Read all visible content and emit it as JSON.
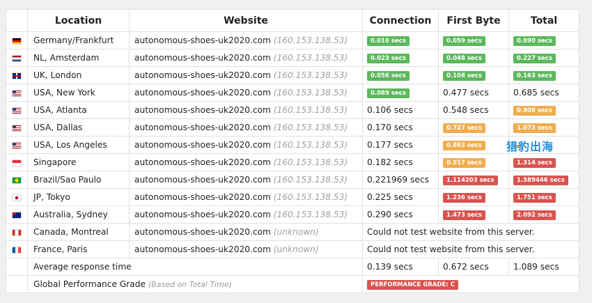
{
  "headers": {
    "location": "Location",
    "website": "Website",
    "connection": "Connection",
    "first_byte": "First Byte",
    "total": "Total"
  },
  "rows": [
    {
      "flag": "de",
      "location": "Germany/Frankfurt",
      "site": "autonomous-shoes-uk2020.com",
      "ip": "(160.153.138.53)",
      "connection": {
        "text": "0.010 secs",
        "style": "green"
      },
      "first_byte": {
        "text": "0.059 secs",
        "style": "green"
      },
      "total": {
        "text": "0.090 secs",
        "style": "green"
      }
    },
    {
      "flag": "nl",
      "location": "NL, Amsterdam",
      "site": "autonomous-shoes-uk2020.com",
      "ip": "(160.153.138.53)",
      "connection": {
        "text": "0.023 secs",
        "style": "green"
      },
      "first_byte": {
        "text": "0.048 secs",
        "style": "green"
      },
      "total": {
        "text": "0.227 secs",
        "style": "green"
      }
    },
    {
      "flag": "gb",
      "location": "UK, London",
      "site": "autonomous-shoes-uk2020.com",
      "ip": "(160.153.138.53)",
      "connection": {
        "text": "0.056 secs",
        "style": "green"
      },
      "first_byte": {
        "text": "0.108 secs",
        "style": "green"
      },
      "total": {
        "text": "0.163 secs",
        "style": "green"
      }
    },
    {
      "flag": "us",
      "location": "USA, New York",
      "site": "autonomous-shoes-uk2020.com",
      "ip": "(160.153.138.53)",
      "connection": {
        "text": "0.089 secs",
        "style": "green"
      },
      "first_byte": {
        "text": "0.477 secs",
        "style": "plain"
      },
      "total": {
        "text": "0.685 secs",
        "style": "plain"
      }
    },
    {
      "flag": "us",
      "location": "USA, Atlanta",
      "site": "autonomous-shoes-uk2020.com",
      "ip": "(160.153.138.53)",
      "connection": {
        "text": "0.106 secs",
        "style": "plain"
      },
      "first_byte": {
        "text": "0.548 secs",
        "style": "plain"
      },
      "total": {
        "text": "0.906 secs",
        "style": "orange"
      }
    },
    {
      "flag": "us",
      "location": "USA, Dallas",
      "site": "autonomous-shoes-uk2020.com",
      "ip": "(160.153.138.53)",
      "connection": {
        "text": "0.170 secs",
        "style": "plain"
      },
      "first_byte": {
        "text": "0.727 secs",
        "style": "orange"
      },
      "total": {
        "text": "1.073 secs",
        "style": "orange"
      }
    },
    {
      "flag": "us",
      "location": "USA, Los Angeles",
      "site": "autonomous-shoes-uk2020.com",
      "ip": "(160.153.138.53)",
      "connection": {
        "text": "0.177 secs",
        "style": "plain"
      },
      "first_byte": {
        "text": "0.863 secs",
        "style": "orange"
      },
      "total": {
        "text": "",
        "style": "orange"
      }
    },
    {
      "flag": "sg",
      "location": "Singapore",
      "site": "autonomous-shoes-uk2020.com",
      "ip": "(160.153.138.53)",
      "connection": {
        "text": "0.182 secs",
        "style": "plain"
      },
      "first_byte": {
        "text": "0.917 secs",
        "style": "orange"
      },
      "total": {
        "text": "1.314 secs",
        "style": "red"
      }
    },
    {
      "flag": "br",
      "location": "Brazil/Sao Paulo",
      "site": "autonomous-shoes-uk2020.com",
      "ip": "(160.153.138.53)",
      "connection": {
        "text": "0.221969 secs",
        "style": "plain"
      },
      "first_byte": {
        "text": "1.114203 secs",
        "style": "red"
      },
      "total": {
        "text": "1.589446 secs",
        "style": "red"
      }
    },
    {
      "flag": "jp",
      "location": "JP, Tokyo",
      "site": "autonomous-shoes-uk2020.com",
      "ip": "(160.153.138.53)",
      "connection": {
        "text": "0.225 secs",
        "style": "plain"
      },
      "first_byte": {
        "text": "1.236 secs",
        "style": "red"
      },
      "total": {
        "text": "1.751 secs",
        "style": "red"
      }
    },
    {
      "flag": "au",
      "location": "Australia, Sydney",
      "site": "autonomous-shoes-uk2020.com",
      "ip": "(160.153.138.53)",
      "connection": {
        "text": "0.290 secs",
        "style": "plain"
      },
      "first_byte": {
        "text": "1.473 secs",
        "style": "red"
      },
      "total": {
        "text": "2.092 secs",
        "style": "red"
      }
    },
    {
      "flag": "ca",
      "location": "Canada, Montreal",
      "site": "autonomous-shoes-uk2020.com",
      "ip": "(unknown)",
      "message": "Could not test website from this server."
    },
    {
      "flag": "fr",
      "location": "France, Paris",
      "site": "autonomous-shoes-uk2020.com",
      "ip": "(unknown)",
      "message": "Could not test website from this server."
    }
  ],
  "average": {
    "label": "Average response time",
    "connection": "0.139 secs",
    "first_byte": "0.672 secs",
    "total": "1.089 secs"
  },
  "grade": {
    "label": "Global Performance Grade",
    "note": "(Based on Total Time)",
    "badge": "PERFORMANCE GRADE: C"
  },
  "watermark": "猎豹出海"
}
